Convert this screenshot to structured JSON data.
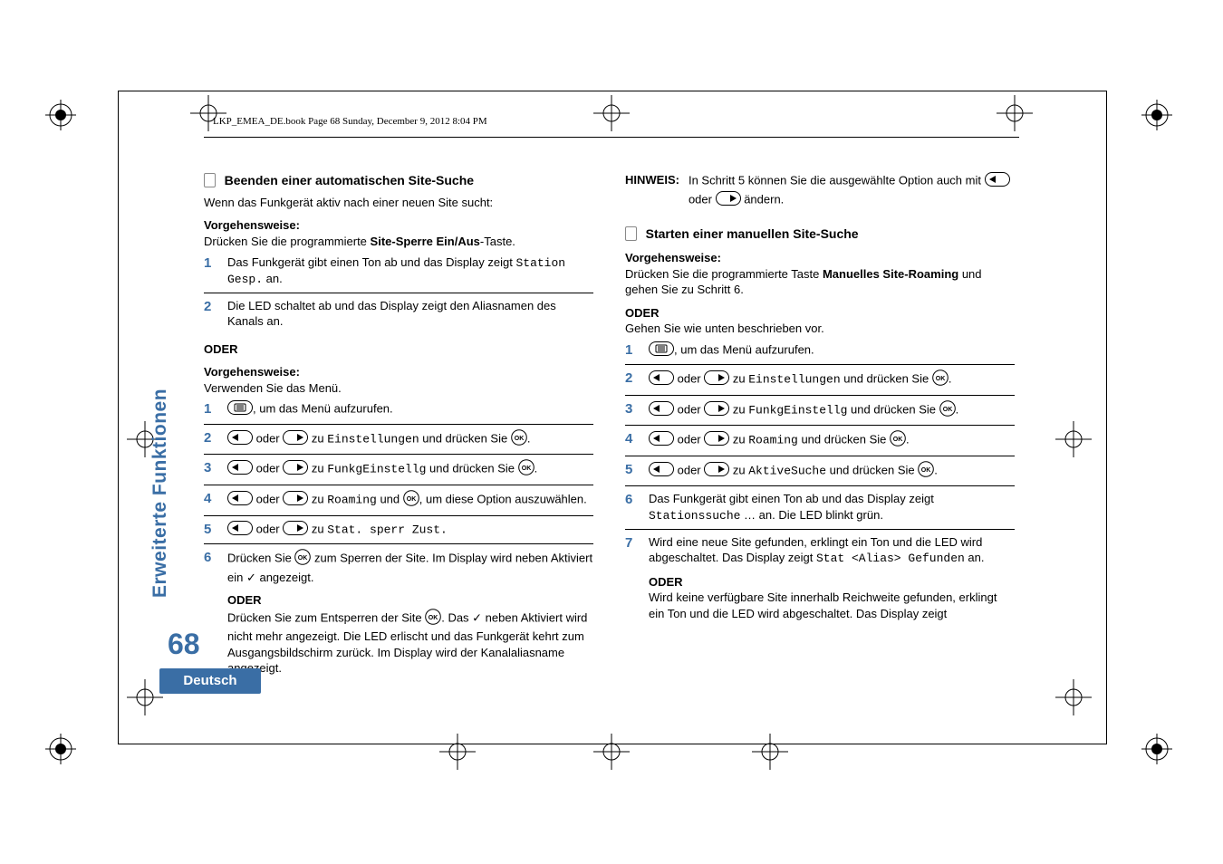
{
  "header": "LKP_EMEA_DE.book  Page 68  Sunday, December 9, 2012  8:04 PM",
  "sidebar": "Erweiterte Funktionen",
  "pagenum": "68",
  "lang": "Deutsch",
  "left": {
    "title": "Beenden einer automatischen Site-Suche",
    "intro": "Wenn das Funkgerät aktiv nach einer neuen Site sucht:",
    "proc": "Vorgehensweise:",
    "proc_line1a": "Drücken Sie die programmierte ",
    "proc_line1b": "Site-Sperre Ein/Aus",
    "proc_line1c": "-Taste.",
    "s1a": "Das Funkgerät gibt einen Ton ab und das Display zeigt ",
    "s1b": "Station Gesp.",
    "s1c": " an.",
    "s2": "Die LED schaltet ab und das Display zeigt den Aliasnamen des Kanals an.",
    "or": "ODER",
    "proc2": "Vorgehensweise:",
    "proc2_line": "Verwenden Sie das Menü.",
    "m1": ", um das Menü aufzurufen.",
    "m2a": " oder ",
    "m2b": " zu ",
    "m2c": "Einstellungen",
    "m2d": " und drücken Sie ",
    "m3c": "FunkgEinstellg",
    "m4c": "Roaming",
    "m4d": " und ",
    "m4e": ", um diese Option auszuwählen.",
    "m5c": "Stat. sperr Zust.",
    "m6a": "Drücken Sie ",
    "m6b": " zum Sperren der Site. Im Display wird neben Aktiviert ein ✓ angezeigt.",
    "m6or": "ODER",
    "m6c": "Drücken Sie zum Entsperren der Site ",
    "m6d": ". Das ✓ neben Aktiviert wird nicht mehr angezeigt. Die LED erlischt und das Funkgerät kehrt zum Ausgangsbildschirm zurück. Im Display wird der Kanalaliasname angezeigt."
  },
  "right": {
    "hinweis": "HINWEIS:",
    "hinweis_a": "In Schritt 5 können Sie die ausgewählte Option auch mit ",
    "hinweis_b": " oder ",
    "hinweis_c": " ändern.",
    "title": "Starten einer manuellen Site-Suche",
    "proc": "Vorgehensweise:",
    "p1a": "Drücken Sie die programmierte Taste ",
    "p1b": "Manuelles Site-Roaming",
    "p1c": " und gehen Sie zu Schritt 6.",
    "or": "ODER",
    "p2": "Gehen Sie wie unten beschrieben vor.",
    "r1": ", um das Menü aufzurufen.",
    "r2a": " oder ",
    "r2b": " zu ",
    "r2c": "Einstellungen",
    "r2d": " und drücken Sie ",
    "r3c": "FunkgEinstellg",
    "r4c": "Roaming",
    "r5c": "AktiveSuche",
    "r6a": "Das Funkgerät gibt einen Ton ab und das Display zeigt ",
    "r6b": "Stationssuche",
    "r6c": " … an. Die LED blinkt grün.",
    "r7a": "Wird eine neue Site gefunden, erklingt ein Ton und die LED wird abgeschaltet. Das Display zeigt ",
    "r7b": "Stat <Alias> Gefunden",
    "r7c": " an.",
    "r7or": "ODER",
    "r7d": "Wird keine verfügbare Site innerhalb Reichweite gefunden, erklingt ein Ton und die LED wird abgeschaltet. Das Display zeigt"
  },
  "nums": {
    "n1": "1",
    "n2": "2",
    "n3": "3",
    "n4": "4",
    "n5": "5",
    "n6": "6",
    "n7": "7"
  }
}
